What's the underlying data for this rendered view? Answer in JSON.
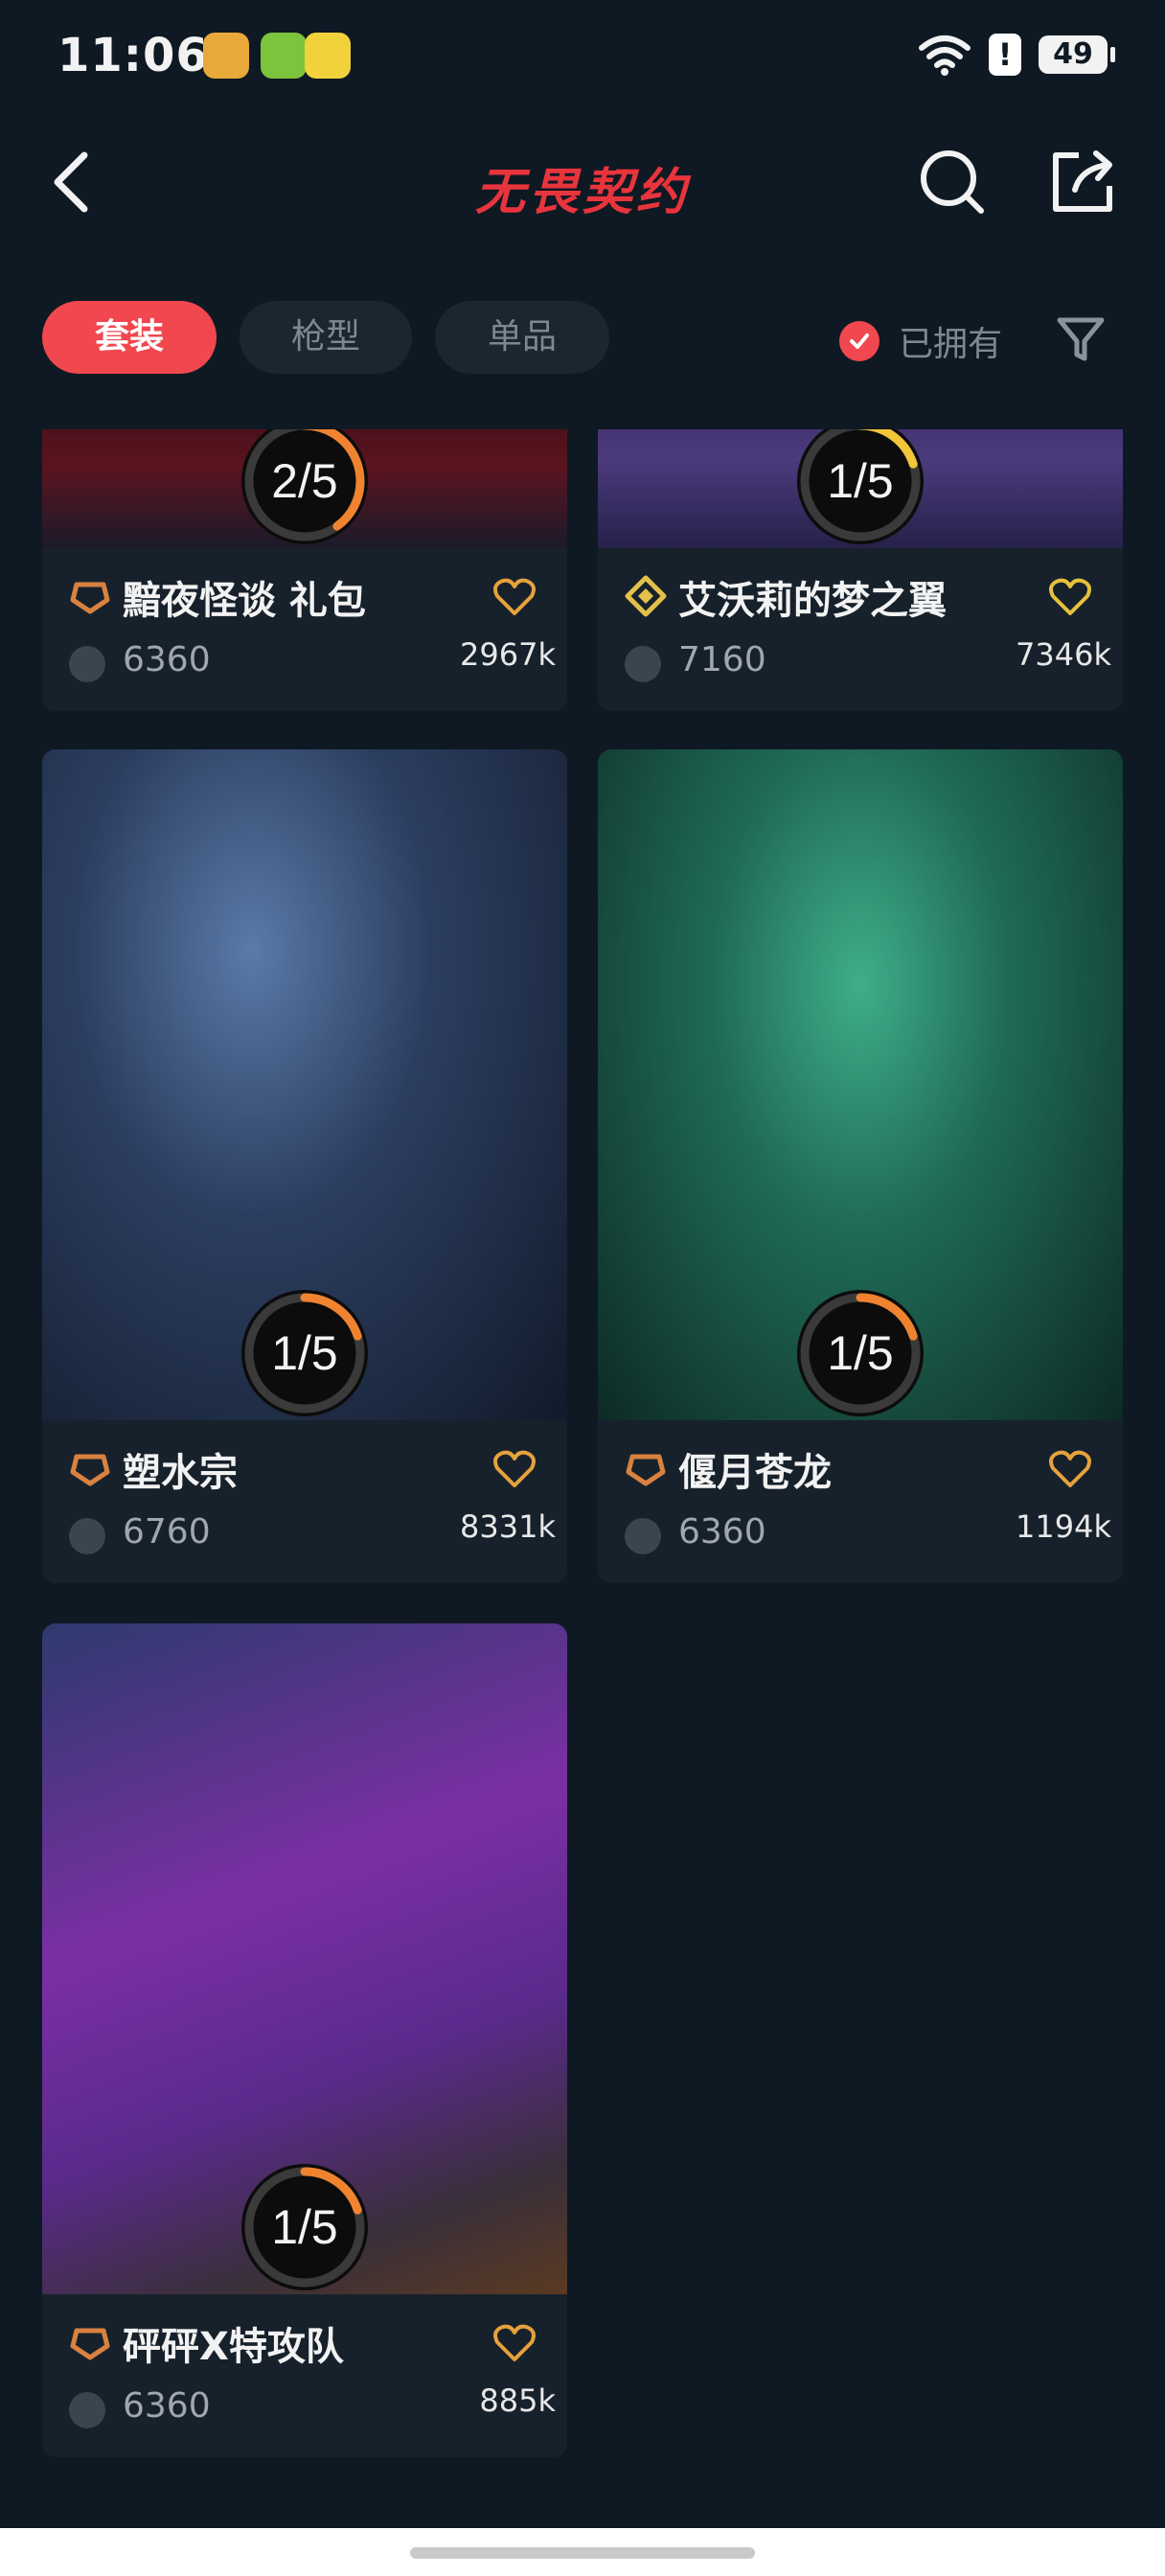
{
  "status_bar": {
    "time": "11:06",
    "battery": "49"
  },
  "header": {
    "title": "无畏契约"
  },
  "filters": {
    "tabs": [
      {
        "label": "套装",
        "active": true
      },
      {
        "label": "枪型",
        "active": false
      },
      {
        "label": "单品",
        "active": false
      }
    ],
    "owned_label": "已拥有"
  },
  "colors": {
    "accent": "#f0484e",
    "background": "#0f1923",
    "card": "#17212b"
  },
  "bundles": [
    {
      "name": "黯夜怪谈 礼包",
      "price": "6360",
      "likes": "2967k",
      "owned": "2/5",
      "owned_fraction": 0.4,
      "tier": "premium-icon"
    },
    {
      "name": "艾沃莉的梦之翼",
      "price": "7160",
      "likes": "7346k",
      "owned": "1/5",
      "owned_fraction": 0.2,
      "tier": "exclusive-icon"
    },
    {
      "name": "塑水宗",
      "price": "6760",
      "likes": "8331k",
      "owned": "1/5",
      "owned_fraction": 0.2,
      "tier": "premium-icon"
    },
    {
      "name": "偃月苍龙",
      "price": "6360",
      "likes": "1194k",
      "owned": "1/5",
      "owned_fraction": 0.2,
      "tier": "premium-icon"
    },
    {
      "name": "砰砰X特攻队",
      "price": "6360",
      "likes": "885k",
      "owned": "1/5",
      "owned_fraction": 0.2,
      "tier": "premium-icon"
    }
  ]
}
